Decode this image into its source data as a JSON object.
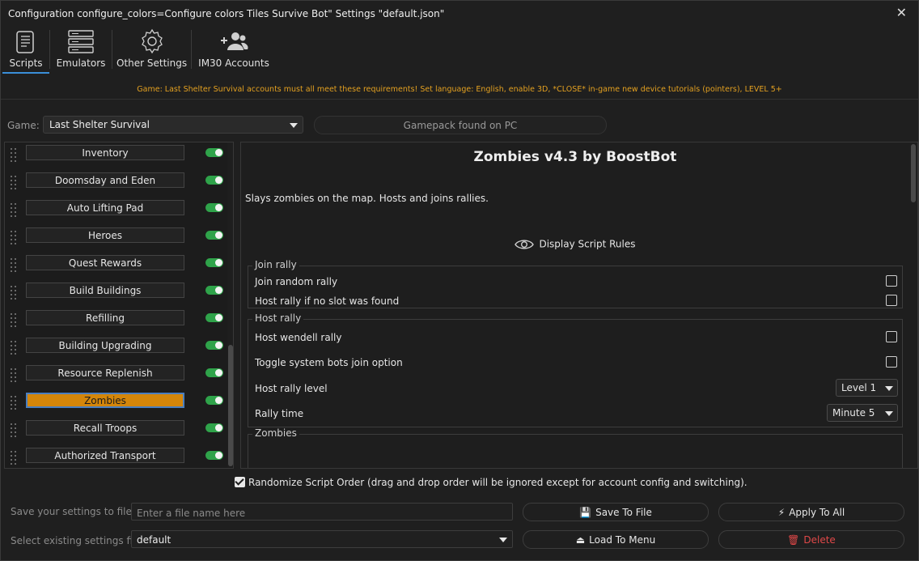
{
  "window": {
    "title": "Configuration configure_colors=Configure colors Tiles Survive Bot\" Settings \"default.json\"",
    "close_glyph": "✕"
  },
  "tabs": [
    {
      "label": "Scripts",
      "icon": "scroll-icon",
      "active": true
    },
    {
      "label": "Emulators",
      "icon": "server-icon",
      "active": false
    },
    {
      "label": "Other Settings",
      "icon": "gear-icon",
      "active": false
    },
    {
      "label": "IM30 Accounts",
      "icon": "users-icon",
      "active": false
    }
  ],
  "notice": "Game: Last Shelter Survival accounts must all meet these requirements! Set language: English, enable 3D, *CLOSE* in-game new device tutorials (pointers), LEVEL 5+",
  "game": {
    "label": "Game:",
    "selected": "Last Shelter Survival",
    "gamepack_status": "Gamepack found on PC"
  },
  "scripts": [
    {
      "label": "Inventory",
      "enabled": true,
      "active": false
    },
    {
      "label": "Doomsday and Eden",
      "enabled": true,
      "active": false
    },
    {
      "label": "Auto Lifting Pad",
      "enabled": true,
      "active": false
    },
    {
      "label": "Heroes",
      "enabled": true,
      "active": false
    },
    {
      "label": "Quest Rewards",
      "enabled": true,
      "active": false
    },
    {
      "label": "Build Buildings",
      "enabled": true,
      "active": false
    },
    {
      "label": "Refilling",
      "enabled": true,
      "active": false
    },
    {
      "label": "Building Upgrading",
      "enabled": true,
      "active": false
    },
    {
      "label": "Resource Replenish",
      "enabled": true,
      "active": false
    },
    {
      "label": "Zombies",
      "enabled": true,
      "active": true
    },
    {
      "label": "Recall Troops",
      "enabled": true,
      "active": false
    },
    {
      "label": "Authorized Transport",
      "enabled": true,
      "active": false
    }
  ],
  "detail": {
    "title": "Zombies v4.3 by BoostBot",
    "description": "Slays zombies on the map. Hosts and joins rallies.",
    "rules_label": "Display Script Rules",
    "join_rally": {
      "title": "Join rally",
      "options": [
        {
          "label": "Join random rally",
          "checked": false
        },
        {
          "label": "Host rally if no slot was found",
          "checked": false
        }
      ]
    },
    "host_rally": {
      "title": "Host rally",
      "options": [
        {
          "label": "Host wendell rally",
          "checked": false
        },
        {
          "label": "Toggle system bots join option",
          "checked": false
        }
      ],
      "rally_level_label": "Host rally level",
      "rally_level_value": "Level 1",
      "rally_time_label": "Rally time",
      "rally_time_value": "Minute 5"
    },
    "zombies_group_title": "Zombies"
  },
  "randomize": {
    "label": "Randomize Script Order (drag and drop order will be ignored except for account config and switching).",
    "checked": true
  },
  "footer": {
    "save_label": "Save your settings to file",
    "save_placeholder": "Enter a file name here",
    "save_button": "Save To File",
    "apply_button": "Apply To All",
    "select_label": "Select existing settings file",
    "select_value": "default",
    "load_button": "Load To Menu",
    "delete_button": "Delete"
  },
  "colors": {
    "accent_orange": "#d4860a",
    "notice_orange": "#e3a020",
    "toggle_green": "#2fa34a",
    "delete_red": "#e04848",
    "save_gold": "#e0a020",
    "tab_underline": "#3a8fd8"
  }
}
